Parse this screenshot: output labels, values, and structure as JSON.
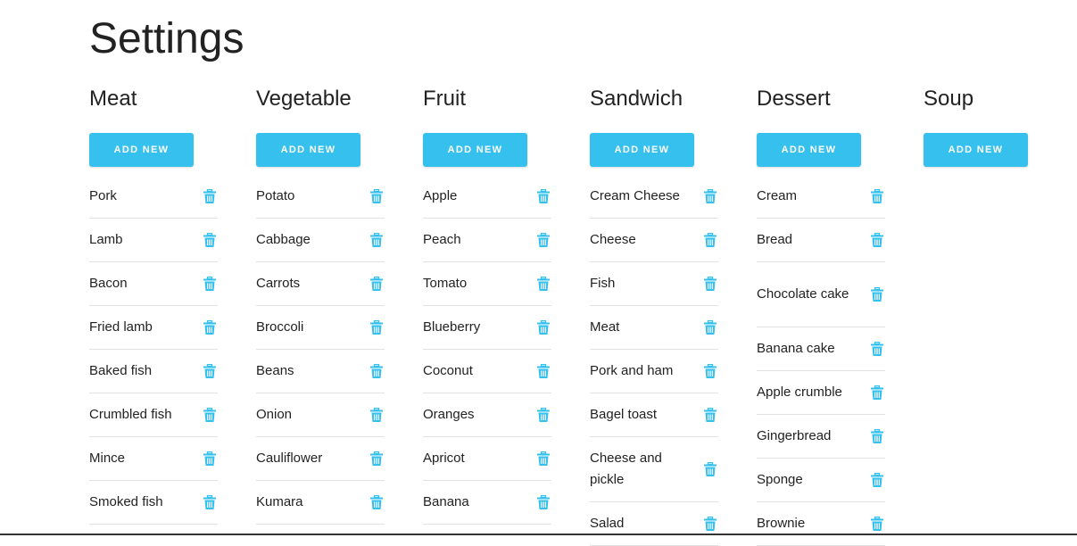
{
  "page": {
    "title": "Settings"
  },
  "accent_color": "#35c0ee",
  "columns": [
    {
      "title": "Meat",
      "add_label": "ADD NEW",
      "items": [
        "Pork",
        "Lamb",
        "Bacon",
        "Fried lamb",
        "Baked fish",
        "Crumbled fish",
        "Mince",
        "Smoked fish"
      ]
    },
    {
      "title": "Vegetable",
      "add_label": "ADD NEW",
      "items": [
        "Potato",
        "Cabbage",
        "Carrots",
        "Broccoli",
        "Beans",
        "Onion",
        "Cauliflower",
        "Kumara"
      ]
    },
    {
      "title": "Fruit",
      "add_label": "ADD NEW",
      "items": [
        "Apple",
        "Peach",
        "Tomato",
        "Blueberry",
        "Coconut",
        "Oranges",
        "Apricot",
        "Banana"
      ]
    },
    {
      "title": "Sandwich",
      "add_label": "ADD NEW",
      "items": [
        "Cream Cheese",
        "Cheese",
        "Fish",
        "Meat",
        "Pork and ham",
        "Bagel toast",
        "Cheese and pickle",
        "Salad"
      ]
    },
    {
      "title": "Dessert",
      "add_label": "ADD NEW",
      "items": [
        "Cream",
        "Bread",
        "Chocolate cake",
        "Banana cake",
        "Apple crumble",
        "Gingerbread",
        "Sponge",
        "Brownie"
      ]
    },
    {
      "title": "Soup",
      "add_label": "ADD NEW",
      "items": []
    }
  ],
  "icons": {
    "delete": "trash-icon"
  }
}
